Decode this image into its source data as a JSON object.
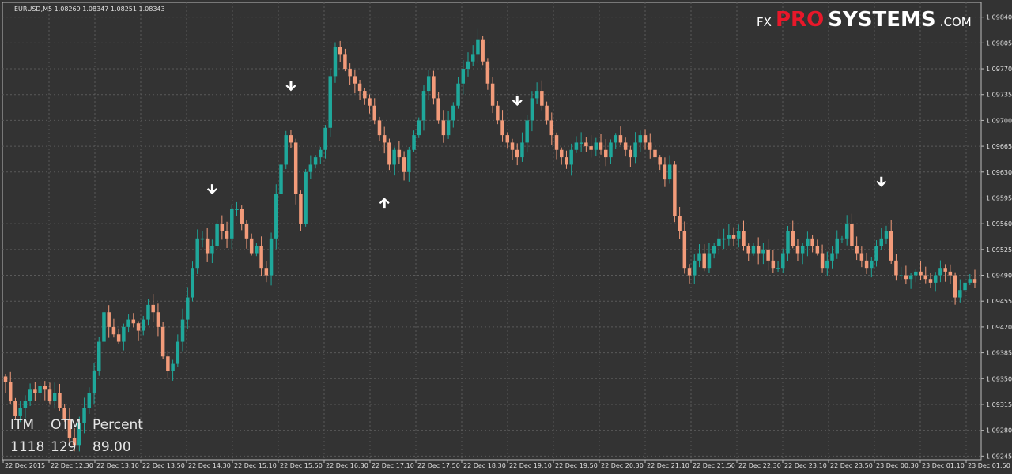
{
  "chart_data": {
    "type": "candlestick",
    "symbol_line": "EURUSD,M5  1.08269 1.08347 1.08251 1.08343",
    "brand": {
      "prefix": "FX",
      "highlight": "PRO",
      "rest": "SYSTEMS",
      "suffix": ".COM"
    },
    "ylim": [
      1.0924,
      1.0986
    ],
    "y_ticks": [
      "1.09840",
      "1.09805",
      "1.09770",
      "1.09735",
      "1.09700",
      "1.09665",
      "1.09630",
      "1.09595",
      "1.09560",
      "1.09525",
      "1.09490",
      "1.09455",
      "1.09420",
      "1.09385",
      "1.09350",
      "1.09315",
      "1.09280",
      "1.09245"
    ],
    "x_ticks": [
      "22 Dec 2015",
      "22 Dec 12:30",
      "22 Dec 13:10",
      "22 Dec 13:50",
      "22 Dec 14:30",
      "22 Dec 15:10",
      "22 Dec 15:50",
      "22 Dec 16:30",
      "22 Dec 17:10",
      "22 Dec 17:50",
      "22 Dec 18:30",
      "22 Dec 19:10",
      "22 Dec 19:50",
      "22 Dec 20:30",
      "22 Dec 21:10",
      "22 Dec 21:50",
      "22 Dec 22:30",
      "22 Dec 23:10",
      "22 Dec 23:50",
      "23 Dec 00:30",
      "23 Dec 01:10",
      "23 Dec 01:50"
    ],
    "grid": true,
    "colors": {
      "background": "#333333",
      "bull": "#1fa89b",
      "bear": "#f29b7a",
      "grid": "#5a5a5a",
      "axis_text": "#e0e0e0",
      "brand_red": "#e8182a",
      "arrow": "#ffffff"
    },
    "closes": [
      1.09345,
      1.0932,
      1.093,
      1.0931,
      1.0932,
      1.09335,
      1.0933,
      1.0934,
      1.09335,
      1.0932,
      1.0933,
      1.0931,
      1.09295,
      1.0927,
      1.0926,
      1.0929,
      1.0931,
      1.0933,
      1.0936,
      1.094,
      1.0944,
      1.0942,
      1.0941,
      1.094,
      1.0942,
      1.0943,
      1.09425,
      1.09415,
      1.0943,
      1.0945,
      1.0944,
      1.0942,
      1.0938,
      1.0936,
      1.0937,
      1.094,
      1.0943,
      1.0946,
      1.095,
      1.0954,
      1.0954,
      1.0952,
      1.0953,
      1.0956,
      1.0955,
      1.0954,
      1.0958,
      1.0958,
      1.0956,
      1.0954,
      1.0952,
      1.0953,
      1.095,
      1.0949,
      1.0954,
      1.096,
      1.0964,
      1.0968,
      1.0967,
      1.096,
      1.0956,
      1.0963,
      1.0964,
      1.0965,
      1.0966,
      1.0969,
      1.0976,
      1.098,
      1.0979,
      1.0977,
      1.0976,
      1.0975,
      1.0974,
      1.0973,
      1.0972,
      1.097,
      1.0968,
      1.0967,
      1.0964,
      1.0966,
      1.0965,
      1.0963,
      1.0966,
      1.0968,
      1.097,
      1.0974,
      1.0976,
      1.0973,
      1.097,
      1.0968,
      1.097,
      1.0972,
      1.0975,
      1.0977,
      1.0978,
      1.0979,
      1.0981,
      1.0978,
      1.0975,
      1.0972,
      1.097,
      1.0968,
      1.0967,
      1.0966,
      1.0965,
      1.0967,
      1.097,
      1.0973,
      1.0974,
      1.0972,
      1.097,
      1.0968,
      1.0966,
      1.0965,
      1.0964,
      1.0966,
      1.0967,
      1.0967,
      1.09665,
      1.0966,
      1.0967,
      1.0966,
      1.0965,
      1.0967,
      1.0968,
      1.0967,
      1.0966,
      1.0965,
      1.0967,
      1.0968,
      1.0967,
      1.0966,
      1.0965,
      1.0964,
      1.0962,
      1.0964,
      1.0957,
      1.0955,
      1.095,
      1.0949,
      1.0951,
      1.0952,
      1.095,
      1.0952,
      1.0953,
      1.0954,
      1.0954,
      1.09545,
      1.0954,
      1.0955,
      1.0953,
      1.0952,
      1.0953,
      1.0952,
      1.09525,
      1.0951,
      1.095,
      1.095,
      1.0952,
      1.0955,
      1.0953,
      1.0952,
      1.0953,
      1.0954,
      1.0953,
      1.0952,
      1.095,
      1.0951,
      1.0952,
      1.0954,
      1.0954,
      1.0956,
      1.0953,
      1.0952,
      1.0951,
      1.095,
      1.0951,
      1.0953,
      1.0954,
      1.0955,
      1.0951,
      1.0949,
      1.0949,
      1.09485,
      1.0949,
      1.09495,
      1.0949,
      1.09485,
      1.0948,
      1.0949,
      1.095,
      1.09495,
      1.0949,
      1.0946,
      1.0947,
      1.0948,
      1.09485,
      1.0948
    ]
  },
  "stats": {
    "itm_label": "ITM",
    "otm_label": "OTM",
    "percent_label": "Percent",
    "itm_value": "1118",
    "otm_value": "129",
    "percent_value": "89.00"
  }
}
